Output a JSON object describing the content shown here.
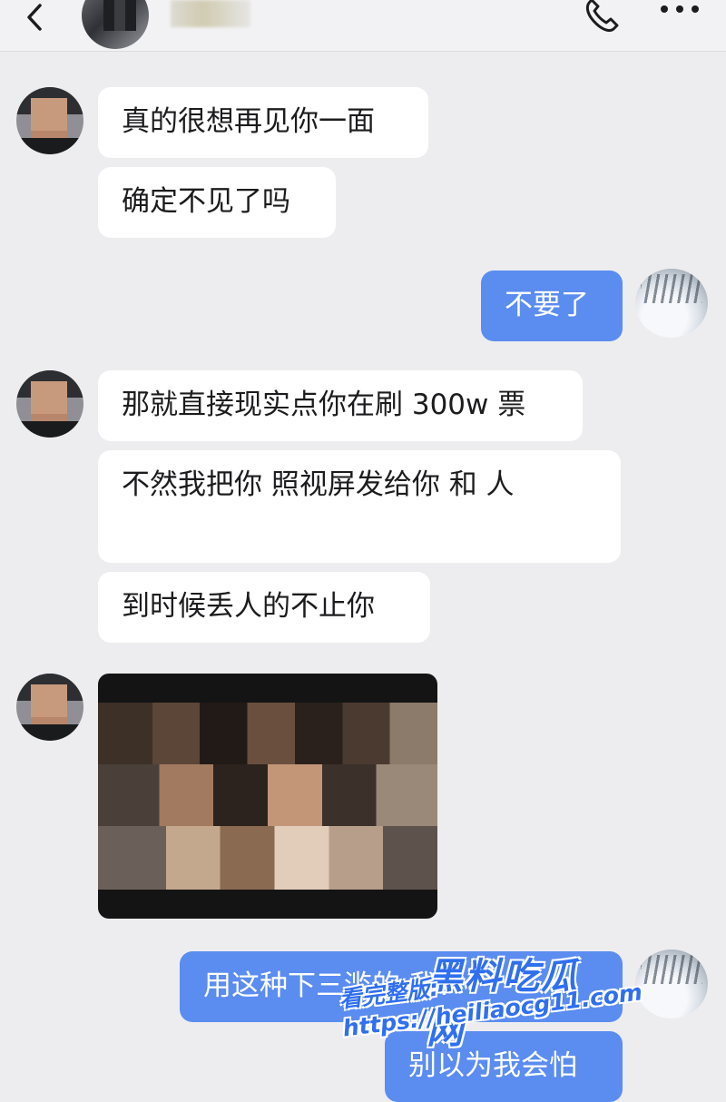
{
  "header": {
    "back_icon": "chevron-left-icon",
    "call_icon": "phone-icon",
    "more_icon": "more-icon"
  },
  "messages": [
    {
      "side": "left",
      "text": "真的很想再见你一面"
    },
    {
      "side": "left",
      "text": "确定不见了吗"
    },
    {
      "side": "right",
      "text": "不要了"
    },
    {
      "side": "left",
      "text": "那就直接现实点你在刷 300w 票"
    },
    {
      "side": "left",
      "text": "不然我把你 照视屏发给你 和 人"
    },
    {
      "side": "left",
      "text": "到时候丢人的不止你"
    },
    {
      "side": "left",
      "type": "video"
    },
    {
      "side": "right",
      "text": "用这种下三滥的 我?"
    },
    {
      "side": "right",
      "text": "别以为我会怕"
    }
  ],
  "watermark": {
    "logo": "黑料吃瓜网",
    "prefix": "看完整版:",
    "url": "https://heiliaocg11.com"
  },
  "colors": {
    "background": "#ededf0",
    "received_bubble": "#ffffff",
    "sent_bubble": "#5b8cf0",
    "watermark": "#2f6ff0"
  }
}
